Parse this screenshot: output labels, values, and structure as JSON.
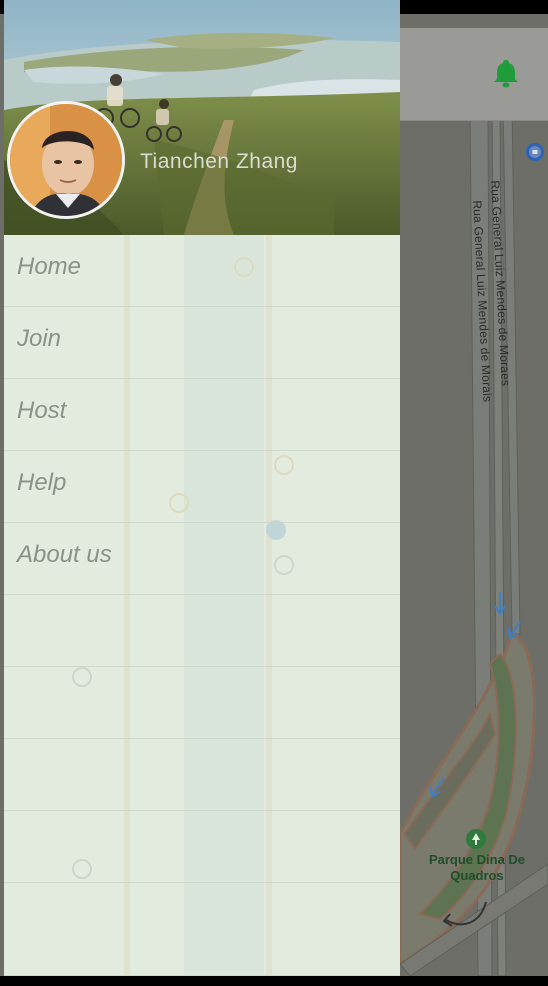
{
  "profile": {
    "name": "Tianchen  Zhang"
  },
  "menu": {
    "items": [
      {
        "label": "Home"
      },
      {
        "label": "Join"
      },
      {
        "label": "Host"
      },
      {
        "label": "Help"
      },
      {
        "label": "About us"
      }
    ]
  },
  "map": {
    "streets": [
      {
        "label": "Rua General Luiz Mendes de Moraes"
      },
      {
        "label": "Rua General Luiz Mendes de Morais"
      }
    ],
    "park": {
      "label": "Parque Dina De Quadros"
    }
  },
  "colors": {
    "bell": "#1f9d3a",
    "drawer_bg": "#ecf3e7",
    "menu_text": "#8b9088",
    "map_shade": "#6b6d66"
  },
  "icons": {
    "bell": "bell-icon",
    "info": "info-icon",
    "park_pin": "park-pin-icon"
  }
}
